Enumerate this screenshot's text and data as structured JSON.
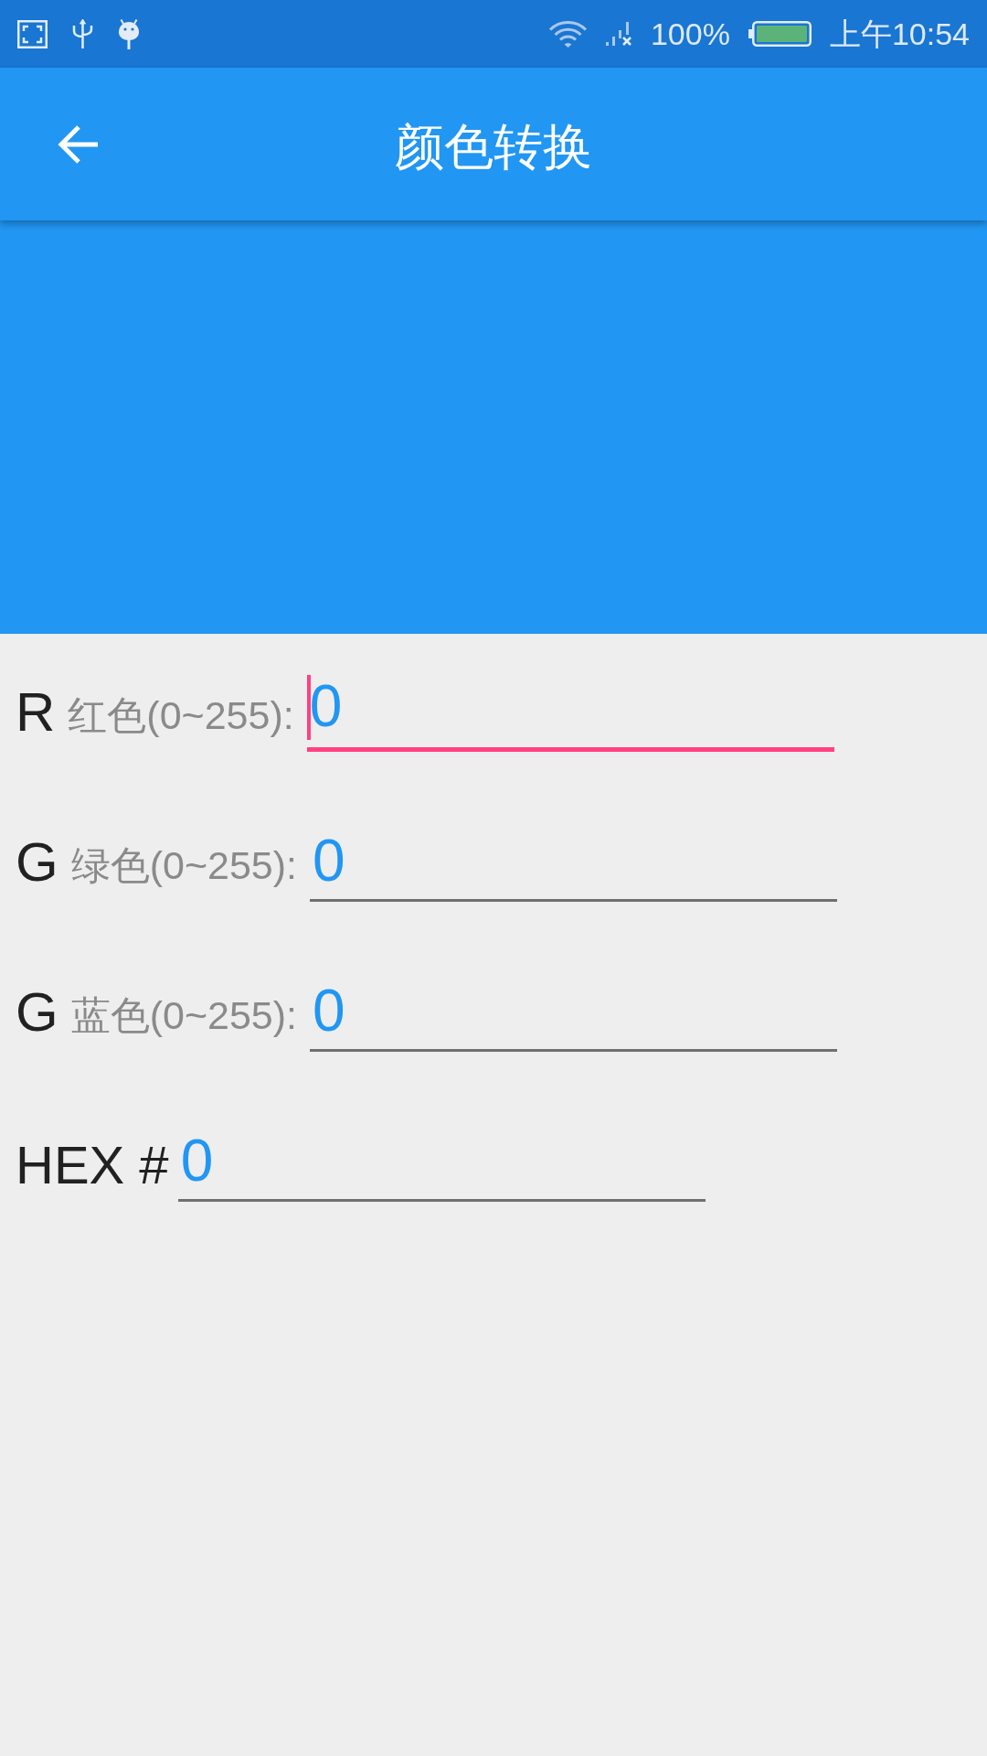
{
  "status_bar": {
    "battery_percent": "100%",
    "time": "上午10:54"
  },
  "app_bar": {
    "title": "颜色转换"
  },
  "fields": [
    {
      "letter": "R",
      "label": "红色(0~255):",
      "value": "0",
      "focused": true
    },
    {
      "letter": "G",
      "label": "绿色(0~255):",
      "value": "0",
      "focused": false
    },
    {
      "letter": "G",
      "label": "蓝色(0~255):",
      "value": "0",
      "focused": false
    }
  ],
  "hex": {
    "label": "HEX #",
    "value": "0",
    "focused": false
  }
}
